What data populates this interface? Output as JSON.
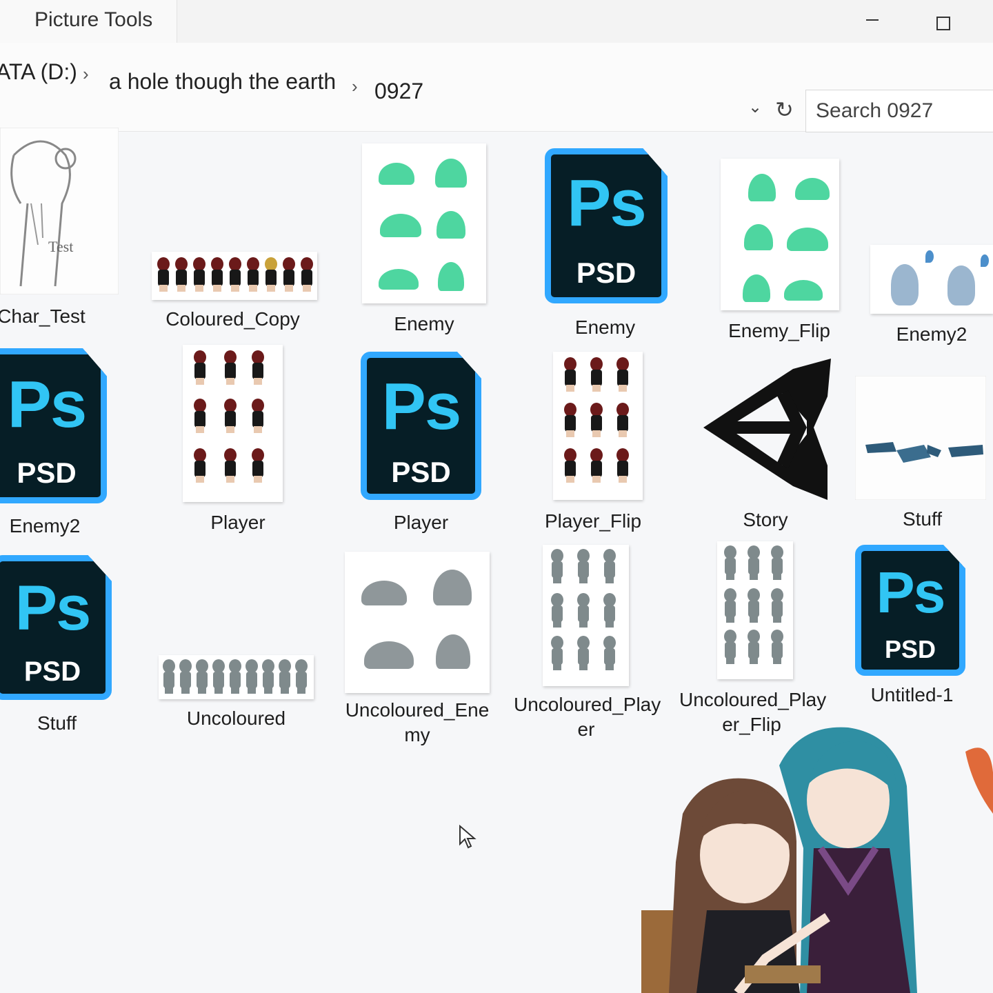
{
  "ribbon": {
    "context_tab": "Picture Tools"
  },
  "address_bar": {
    "crumbs": [
      "ATA (D:)",
      "a hole though the earth",
      "0927"
    ],
    "search_placeholder": "Search 0927"
  },
  "files": {
    "row1": [
      "Char_Test",
      "Coloured_Copy",
      "Enemy",
      "Enemy",
      "Enemy_Flip",
      "Enemy2"
    ],
    "row2": [
      "Enemy2",
      "Player",
      "Player",
      "Player_Flip",
      "Story",
      "Stuff"
    ],
    "row3": [
      "Stuff",
      "Uncoloured",
      "Uncoloured_Ene\nmy",
      "Uncoloured_Play\ner",
      "Uncoloured_Play\ner_Flip",
      "Untitled-1"
    ]
  },
  "psd_icon": {
    "letters": "Ps",
    "ext": "PSD"
  },
  "sketch_text": "Test",
  "icons": [
    "minimize-icon",
    "maximize-icon",
    "breadcrumb-chevron-icon",
    "recent-locations-chevron-icon",
    "refresh-icon",
    "photoshop-icon",
    "unity-icon",
    "mouse-cursor-icon"
  ],
  "colors": {
    "ps_border": "#31a8ff",
    "ps_bg": "#061e26",
    "ps_letters": "#31c5f4",
    "slime_green": "#4ed6a0",
    "slime_grey": "#8f979a"
  }
}
